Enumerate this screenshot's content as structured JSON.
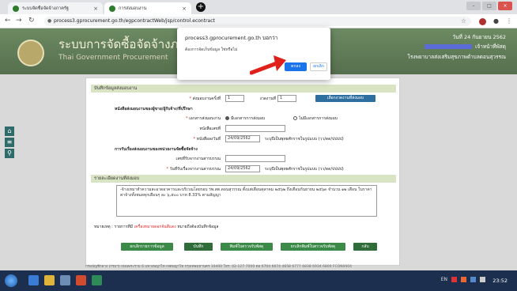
{
  "browser": {
    "tabs": [
      {
        "label": "ระบบจัดซื้อจัดจ้างภาครัฐ"
      },
      {
        "label": "การส่งมอบงาน"
      }
    ],
    "new_tab": "+",
    "url": "process3.gprocurement.go.th/egpcontractWeb/jsp/control.econtract"
  },
  "banner": {
    "title": "ระบบการจัดซื้อจัดจ้างภาครัฐ",
    "subtitle": "Thai Government Procurement",
    "date": "วันที่ 24 กันยายน 2562",
    "user_suffix": "เจ้าหน้าที่พัสดุ",
    "org": "โรงพยาบาลส่งเสริมสุขภาพตำบลดอนสุวรรณ"
  },
  "dialog": {
    "origin": "process3.gprocurement.go.th บอกว่า",
    "message": "ต้องการจัดเก็บข้อมูล ใช่หรือไม่",
    "ok": "ตกลง",
    "cancel": "ยกเลิก"
  },
  "form": {
    "header": "บันทึกข้อมูลส่งมอบงาน",
    "delivery_no_label": "ส่งมอบงานครั้งที่",
    "delivery_no": "1",
    "installment_label": "งวดงานที่",
    "installment": "1",
    "select_installment_btn": "เลือกงวดงานที่ส่งมอบ",
    "notice_heading": "หนังสือส่งมอบงานของผู้ขาย/ผู้รับจ้าง/ที่ปรึกษา",
    "doc_type_label": "เอกสารส่งมอบงาน",
    "radio_has": "มีเอกสารการส่งมอบ",
    "radio_none": "ไม่มีเอกสารการส่งมอบ",
    "letter_no_label": "หนังสือเลขที่",
    "letter_no": "",
    "letter_date_label": "หนังสือลงวันที่",
    "letter_date": "24/09/2562",
    "date_hint": "ระบุปีเป็นพุทธศักราชในรูปแบบ (วว/ดด/ปปปป)",
    "receive_heading": "การรับเรื่องส่งมอบงานของหน่วยงานจัดซื้อจัดจ้าง",
    "receive_no_label": "เลขที่รับจากงานสารบรรณ",
    "receive_no": "",
    "receive_date_label": "วันที่รับเรื่องจากงานสารบรรณ",
    "receive_date": "24/09/2562",
    "detail_header": "รายละเอียดงานที่ส่งมอบ",
    "detail_text": "-จ้างเหมาทำความสะอาดอาคารและบริเวณโดยรอบ รพ.สต.ดอนสุวรรณ ตั้งแต่เดือนตุลาคม ๒๕๖๒ ถึงเดือนกันยายน ๒๕๖๓ จำนวน ๑๒ เดือน ในราคาค่าจ้างทั้งหมดทุกเดือนๆ ละ ๖,๕๐๐ บาท 8.33% ตามสัญญา",
    "note_prefix": "หมายเหตุ : รายการที่มี",
    "note_red": "เครื่องหมายดอกจันสีแดง",
    "note_suffix": "หมายถึงต้องบันทึกข้อมูล",
    "buttons": {
      "cancel_delivery": "ยกเลิกรายการข้อมูล",
      "save": "บันทึก",
      "print_form": "พิมพ์ใบตรวจรับพัสดุ",
      "cancel_print": "ยกเลิกพิมพ์ใบตรวจรับพัสดุ",
      "back": "กลับ"
    }
  },
  "footer": "กรมบัญชีกลาง (กรมฯ) ถนนพระราม 6 แขวงพญาไท เขตพญาไท กรุงเทพมหานคร 10400 โทร. 02-127-7000 ต่อ 6704 6674 4658 6777 6838 6934 6800 FCON0004",
  "taskbar": {
    "lang": "EN",
    "time": "23:52"
  },
  "colors": {
    "banner": "#566f4e",
    "accent_blue": "#1a73e8",
    "button_green": "#3b8a47",
    "section_head": "#d8e4c3",
    "arrow_red": "#e0201a"
  }
}
